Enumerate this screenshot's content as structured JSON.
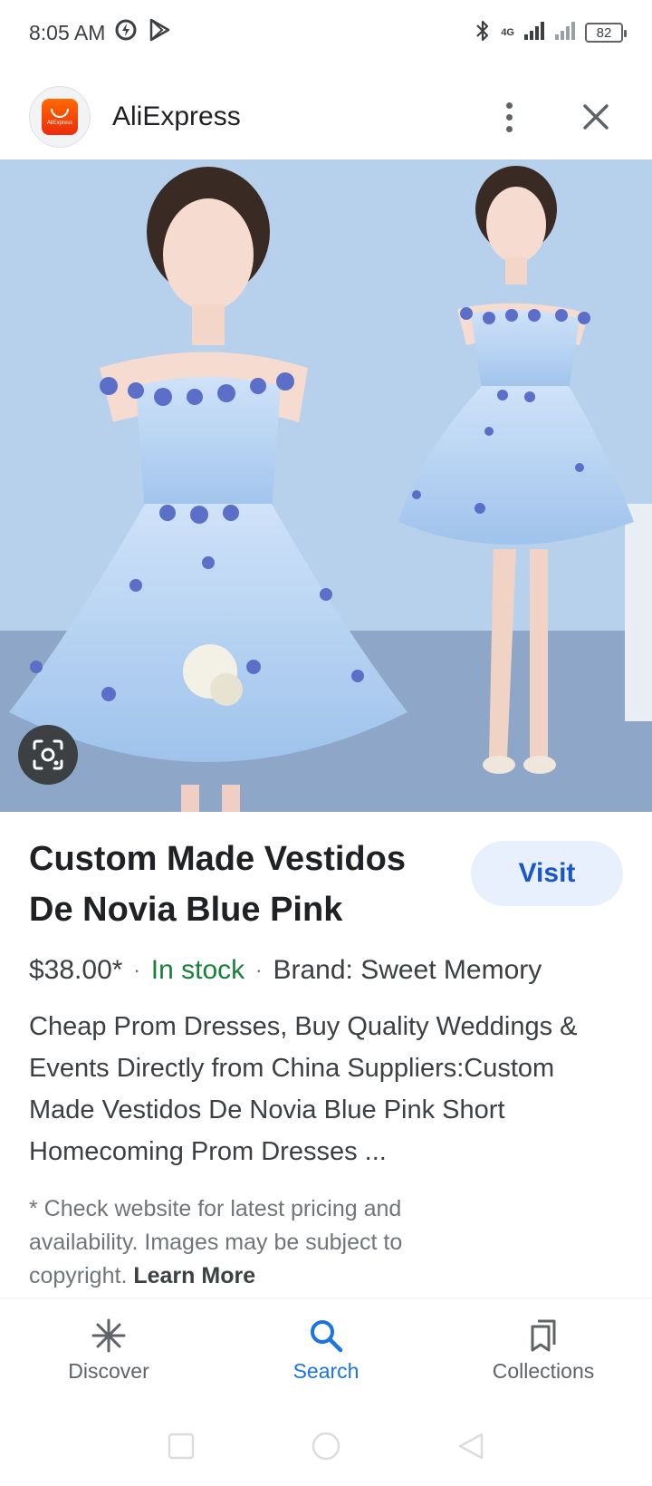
{
  "status_bar": {
    "time": "8:05 AM",
    "network": "4G",
    "battery": "82"
  },
  "header": {
    "app_title": "AliExpress",
    "logo_text": "AliExpress"
  },
  "product": {
    "title": "Custom Made Vestidos De Novia Blue Pink Sho…",
    "visit_label": "Visit",
    "price": "$38.00*",
    "stock": "In stock",
    "brand": "Brand: Sweet Memory",
    "description": "Cheap Prom Dresses, Buy Quality Weddings & Events Directly from China Suppliers:Custom Made Vestidos De Novia Blue Pink Short Homecoming Prom Dresses ...",
    "disclaimer": "* Check website for latest pricing and availability. Images may be subject to copyright.",
    "learn_more": "Learn More"
  },
  "bottom_nav": {
    "items": [
      {
        "label": "Discover",
        "icon": "asterisk-icon",
        "active": false
      },
      {
        "label": "Search",
        "icon": "search-icon",
        "active": true
      },
      {
        "label": "Collections",
        "icon": "bookmarks-icon",
        "active": false
      }
    ]
  },
  "colors": {
    "accent_blue": "#1a73e8",
    "visit_bg": "#e8f0fe",
    "in_stock_green": "#188038",
    "brand_orange": "#ff6a00"
  }
}
